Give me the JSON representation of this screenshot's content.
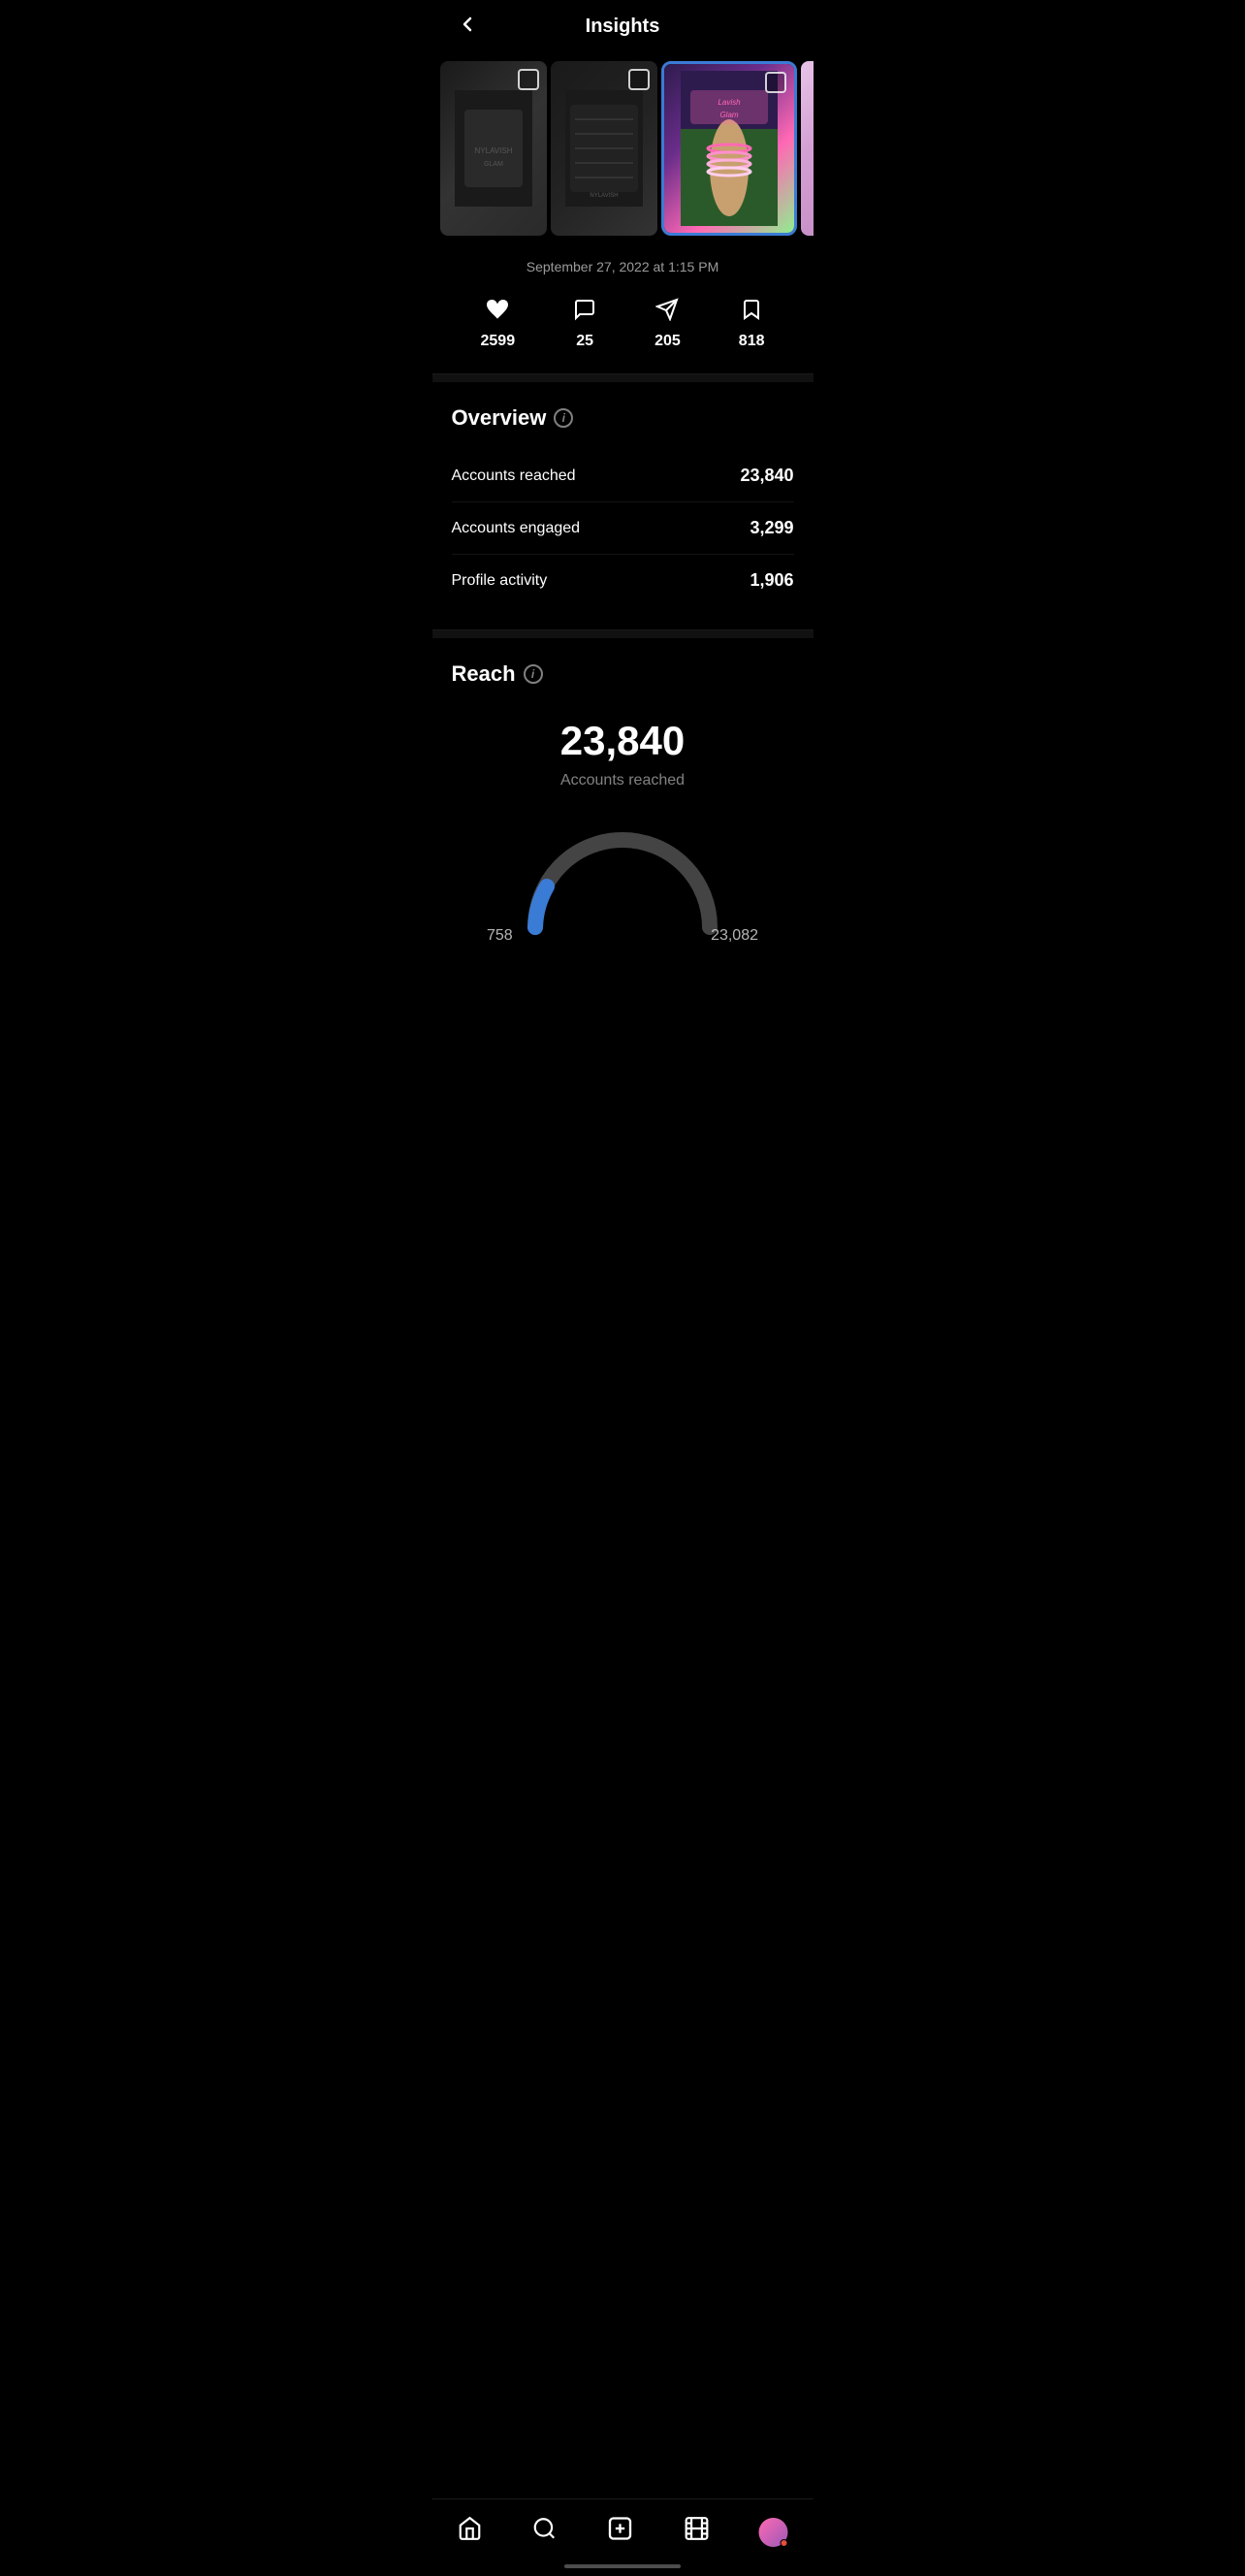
{
  "header": {
    "title": "Insights",
    "back_label": "‹"
  },
  "carousel": {
    "images": [
      {
        "id": 1,
        "label": "img1",
        "style": "img-1",
        "size": "medium"
      },
      {
        "id": 2,
        "label": "img2",
        "style": "img-2",
        "size": "medium"
      },
      {
        "id": 3,
        "label": "img3",
        "style": "img-3",
        "size": "large",
        "highlight": true
      },
      {
        "id": 4,
        "label": "img4",
        "style": "img-4",
        "size": "medium"
      },
      {
        "id": 5,
        "label": "img5",
        "style": "img-5",
        "size": "medium"
      }
    ]
  },
  "post": {
    "timestamp": "September 27, 2022 at 1:15 PM",
    "stats": {
      "likes": "2599",
      "comments": "25",
      "shares": "205",
      "saves": "818"
    }
  },
  "overview": {
    "title": "Overview",
    "info_label": "i",
    "rows": [
      {
        "label": "Accounts reached",
        "value": "23,840"
      },
      {
        "label": "Accounts engaged",
        "value": "3,299"
      },
      {
        "label": "Profile activity",
        "value": "1,906"
      }
    ]
  },
  "reach": {
    "title": "Reach",
    "info_label": "i",
    "number": "23,840",
    "label": "Accounts reached",
    "gauge": {
      "left_value": "758",
      "right_value": "23,082",
      "followers_color": "#3a7bd5",
      "non_followers_color": "#555"
    }
  },
  "bottom_nav": {
    "items": [
      {
        "name": "home",
        "icon": "⌂"
      },
      {
        "name": "search",
        "icon": "🔍"
      },
      {
        "name": "create",
        "icon": "➕"
      },
      {
        "name": "reels",
        "icon": "▶"
      },
      {
        "name": "profile",
        "icon": ""
      }
    ]
  }
}
